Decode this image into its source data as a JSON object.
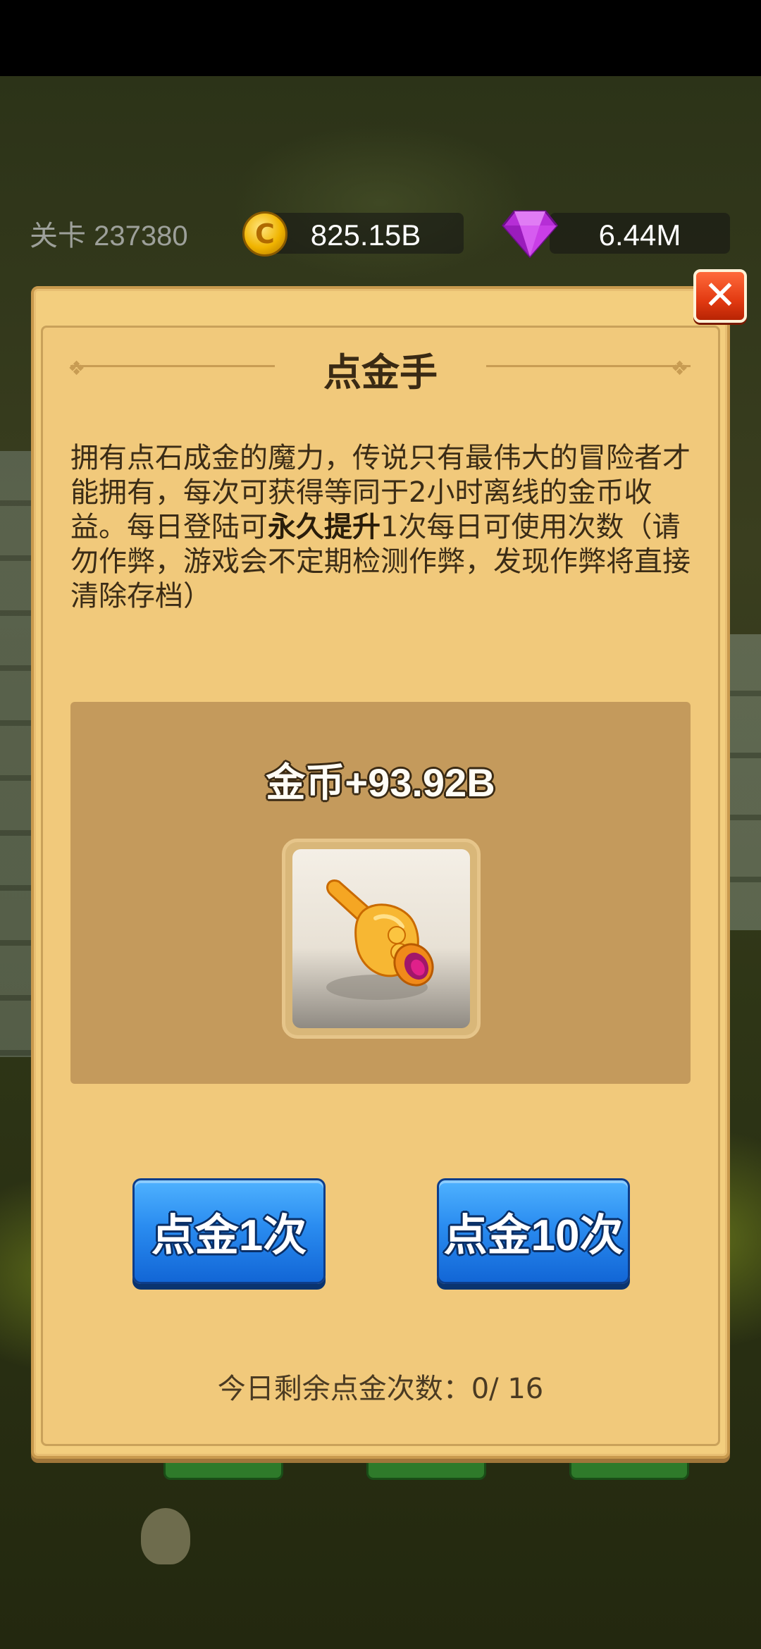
{
  "hud": {
    "level_label": "关卡 237380",
    "coins": "825.15B",
    "gems": "6.44M",
    "coin_icon_glyph": "C"
  },
  "dialog": {
    "title": "点金手",
    "close_glyph": "✕",
    "description_parts": {
      "before": "拥有点石成金的魔力，传说只有最伟大的冒险者才能拥有，每次可获得等同于2小时离线的金币收益。每日登陆可",
      "bold": "永久提升",
      "after": "1次每日可使用次数（请勿作弊，游戏会不定期检测作弊，发现作弊将直接清除存档）"
    },
    "reward_text": "金币+93.92B",
    "buttons": {
      "once": "点金1次",
      "ten": "点金10次"
    },
    "remaining": "今日剩余点金次数：0/ 16"
  },
  "colors": {
    "dialog_bg": "#f3ce7e",
    "reward_panel": "#c49a5c",
    "button_blue": "#2a8cf0",
    "close_red": "#e23a12",
    "gem_purple": "#c23ce0",
    "coin_gold": "#f0b400"
  },
  "icons": {
    "coin": "gold-coin-icon",
    "gem": "purple-diamond-icon",
    "close": "close-icon",
    "hand": "golden-hand-icon"
  }
}
